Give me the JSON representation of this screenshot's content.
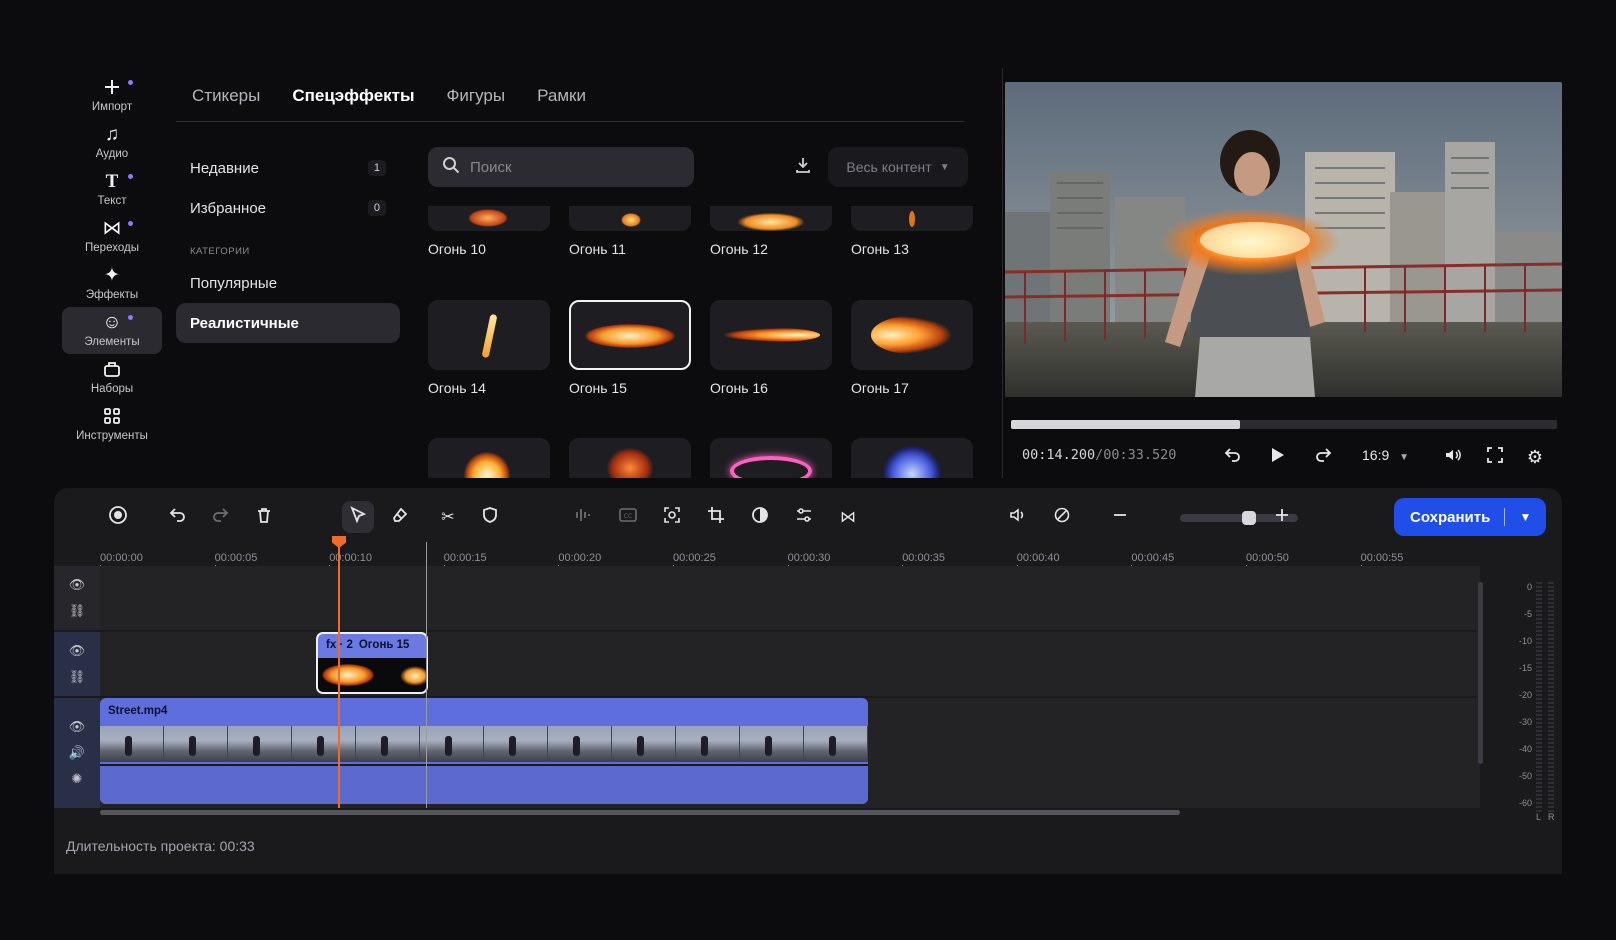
{
  "sidebar": {
    "items": [
      {
        "label": "Импорт",
        "icon": "plus-icon",
        "dot": true
      },
      {
        "label": "Аудио",
        "icon": "music-icon",
        "dot": false
      },
      {
        "label": "Текст",
        "icon": "text-icon",
        "dot": true
      },
      {
        "label": "Переходы",
        "icon": "transitions-icon",
        "dot": true
      },
      {
        "label": "Эффекты",
        "icon": "sparkle-icon",
        "dot": false
      },
      {
        "label": "Элементы",
        "icon": "smiley-icon",
        "dot": true,
        "active": true
      },
      {
        "label": "Наборы",
        "icon": "bundle-icon",
        "dot": false
      },
      {
        "label": "Инструменты",
        "icon": "grid-icon",
        "dot": false
      }
    ]
  },
  "tabs": [
    {
      "label": "Стикеры"
    },
    {
      "label": "Спецэффекты",
      "active": true
    },
    {
      "label": "Фигуры"
    },
    {
      "label": "Рамки"
    }
  ],
  "categories": {
    "recent": {
      "label": "Недавние",
      "count": "1"
    },
    "favorites": {
      "label": "Избранное",
      "count": "0"
    },
    "heading": "КАТЕГОРИИ",
    "popular": {
      "label": "Популярные"
    },
    "realistic": {
      "label": "Реалистичные",
      "active": true
    }
  },
  "search": {
    "placeholder": "Поиск"
  },
  "filter": {
    "label": "Весь контент"
  },
  "effects": [
    {
      "name": "Огонь 10"
    },
    {
      "name": "Огонь 11"
    },
    {
      "name": "Огонь 12"
    },
    {
      "name": "Огонь 13"
    },
    {
      "name": "Огонь 14"
    },
    {
      "name": "Огонь 15",
      "selected": true
    },
    {
      "name": "Огонь 16"
    },
    {
      "name": "Огонь 17"
    },
    {
      "name": ""
    },
    {
      "name": ""
    },
    {
      "name": ""
    },
    {
      "name": ""
    }
  ],
  "preview": {
    "time_current": "00:14.200",
    "time_total": "/00:33.520",
    "progress": 0.42,
    "aspect_ratio": "16:9"
  },
  "timeline": {
    "save_label": "Сохранить",
    "ruler": [
      "00:00:00",
      "00:00:05",
      "00:00:10",
      "00:00:15",
      "00:00:20",
      "00:00:25",
      "00:00:30",
      "00:00:35",
      "00:00:40",
      "00:00:45",
      "00:00:50",
      "00:00:55"
    ],
    "fx_clip": {
      "badge": "fx · 2",
      "name": "Огонь 15"
    },
    "video_clip": {
      "name": "Street.mp4"
    },
    "zoom_level": 0.6,
    "meter_levels": [
      "0",
      "-5",
      "-10",
      "-15",
      "-20",
      "-30",
      "-40",
      "-50",
      "-60"
    ],
    "meter_channels": [
      "L",
      "R"
    ],
    "project_duration": "Длительность проекта: 00:33"
  },
  "colors": {
    "accent": "#1f4fe8",
    "clip": "#5e6fdd",
    "playhead": "#f06a2c",
    "dot": "#8a7bff"
  }
}
